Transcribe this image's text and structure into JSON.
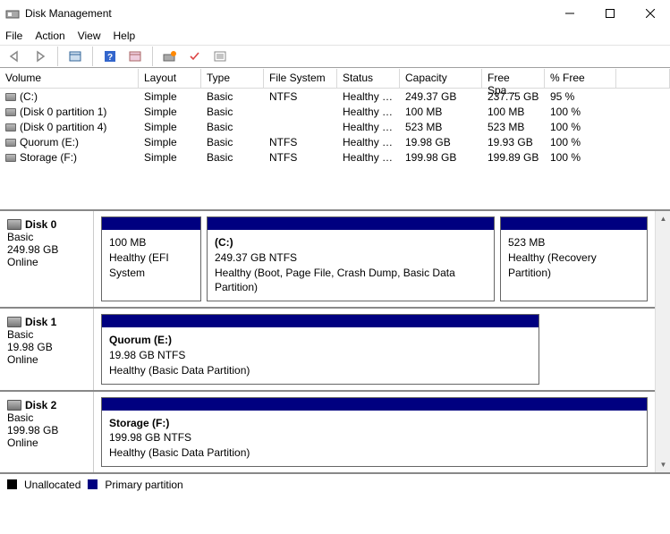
{
  "window": {
    "title": "Disk Management"
  },
  "menu": {
    "file": "File",
    "action": "Action",
    "view": "View",
    "help": "Help"
  },
  "headers": {
    "volume": "Volume",
    "layout": "Layout",
    "type": "Type",
    "fs": "File System",
    "status": "Status",
    "capacity": "Capacity",
    "free": "Free Spa...",
    "pct": "% Free"
  },
  "volumes": [
    {
      "name": "(C:)",
      "layout": "Simple",
      "type": "Basic",
      "fs": "NTFS",
      "status": "Healthy (B...",
      "cap": "249.37 GB",
      "free": "237.75 GB",
      "pct": "95 %"
    },
    {
      "name": "(Disk 0 partition 1)",
      "layout": "Simple",
      "type": "Basic",
      "fs": "",
      "status": "Healthy (E...",
      "cap": "100 MB",
      "free": "100 MB",
      "pct": "100 %"
    },
    {
      "name": "(Disk 0 partition 4)",
      "layout": "Simple",
      "type": "Basic",
      "fs": "",
      "status": "Healthy (R...",
      "cap": "523 MB",
      "free": "523 MB",
      "pct": "100 %"
    },
    {
      "name": "Quorum (E:)",
      "layout": "Simple",
      "type": "Basic",
      "fs": "NTFS",
      "status": "Healthy (B...",
      "cap": "19.98 GB",
      "free": "19.93 GB",
      "pct": "100 %"
    },
    {
      "name": "Storage (F:)",
      "layout": "Simple",
      "type": "Basic",
      "fs": "NTFS",
      "status": "Healthy (B...",
      "cap": "199.98 GB",
      "free": "199.89 GB",
      "pct": "100 %"
    }
  ],
  "disks": [
    {
      "name": "Disk 0",
      "type": "Basic",
      "size": "249.98 GB",
      "status": "Online",
      "parts": [
        {
          "title": "",
          "line1": "100 MB",
          "line2": "Healthy (EFI System",
          "flex": "0 0 112px"
        },
        {
          "title": "(C:)",
          "line1": "249.37 GB NTFS",
          "line2": "Healthy (Boot, Page File, Crash Dump, Basic Data Partition)",
          "flex": "1 1 auto"
        },
        {
          "title": "",
          "line1": "523 MB",
          "line2": "Healthy (Recovery Partition)",
          "flex": "0 0 165px"
        }
      ]
    },
    {
      "name": "Disk 1",
      "type": "Basic",
      "size": "19.98 GB",
      "status": "Online",
      "parts": [
        {
          "title": "Quorum  (E:)",
          "line1": "19.98 GB NTFS",
          "line2": "Healthy (Basic Data Partition)",
          "flex": "0 0 490px"
        }
      ]
    },
    {
      "name": "Disk 2",
      "type": "Basic",
      "size": "199.98 GB",
      "status": "Online",
      "parts": [
        {
          "title": "Storage  (F:)",
          "line1": "199.98 GB NTFS",
          "line2": "Healthy (Basic Data Partition)",
          "flex": "1 1 auto"
        }
      ]
    }
  ],
  "legend": {
    "unalloc": "Unallocated",
    "primary": "Primary partition"
  },
  "colors": {
    "primary": "#000080",
    "unalloc": "#000000"
  }
}
